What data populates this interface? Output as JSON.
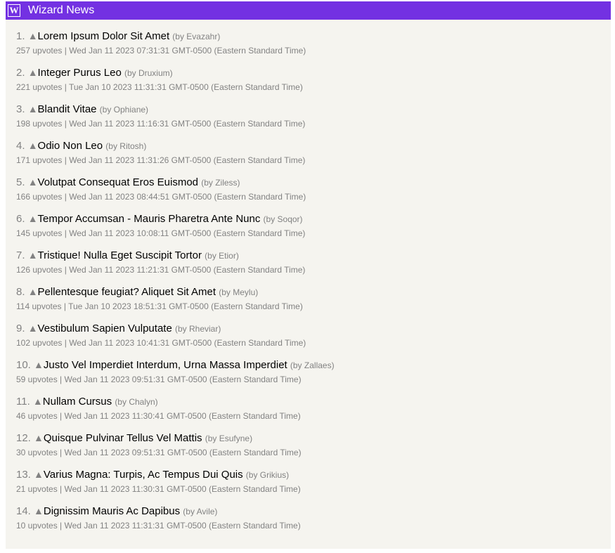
{
  "header": {
    "logo_letter": "W",
    "title": "Wizard News"
  },
  "upvote_icon": "triangle-up",
  "posts": [
    {
      "rank": "1.",
      "title": "Lorem Ipsum Dolor Sit Amet",
      "author": "(by Evazahr)",
      "upvotes": "257 upvotes",
      "date": "Wed Jan 11 2023 07:31:31 GMT-0500 (Eastern Standard Time)"
    },
    {
      "rank": "2.",
      "title": "Integer Purus Leo",
      "author": "(by Druxium)",
      "upvotes": "221 upvotes",
      "date": "Tue Jan 10 2023 11:31:31 GMT-0500 (Eastern Standard Time)"
    },
    {
      "rank": "3.",
      "title": "Blandit Vitae",
      "author": "(by Ophiane)",
      "upvotes": "198 upvotes",
      "date": "Wed Jan 11 2023 11:16:31 GMT-0500 (Eastern Standard Time)"
    },
    {
      "rank": "4.",
      "title": "Odio Non Leo",
      "author": "(by Ritosh)",
      "upvotes": "171 upvotes",
      "date": "Wed Jan 11 2023 11:31:26 GMT-0500 (Eastern Standard Time)"
    },
    {
      "rank": "5.",
      "title": "Volutpat Consequat Eros Euismod",
      "author": "(by Ziless)",
      "upvotes": "166 upvotes",
      "date": "Wed Jan 11 2023 08:44:51 GMT-0500 (Eastern Standard Time)"
    },
    {
      "rank": "6.",
      "title": "Tempor Accumsan - Mauris Pharetra Ante Nunc",
      "author": "(by Soqor)",
      "upvotes": "145 upvotes",
      "date": "Wed Jan 11 2023 10:08:11 GMT-0500 (Eastern Standard Time)"
    },
    {
      "rank": "7.",
      "title": "Tristique! Nulla Eget Suscipit Tortor",
      "author": "(by Etior)",
      "upvotes": "126 upvotes",
      "date": "Wed Jan 11 2023 11:21:31 GMT-0500 (Eastern Standard Time)"
    },
    {
      "rank": "8.",
      "title": "Pellentesque feugiat? Aliquet Sit Amet",
      "author": "(by Meylu)",
      "upvotes": "114 upvotes",
      "date": "Tue Jan 10 2023 18:51:31 GMT-0500 (Eastern Standard Time)"
    },
    {
      "rank": "9.",
      "title": "Vestibulum Sapien Vulputate",
      "author": "(by Rheviar)",
      "upvotes": "102 upvotes",
      "date": "Wed Jan 11 2023 10:41:31 GMT-0500 (Eastern Standard Time)"
    },
    {
      "rank": "10.",
      "title": "Justo Vel Imperdiet Interdum, Urna Massa Imperdiet",
      "author": "(by Zallaes)",
      "upvotes": "59 upvotes",
      "date": "Wed Jan 11 2023 09:51:31 GMT-0500 (Eastern Standard Time)"
    },
    {
      "rank": "11.",
      "title": "Nullam Cursus",
      "author": "(by Chalyn)",
      "upvotes": "46 upvotes",
      "date": "Wed Jan 11 2023 11:30:41 GMT-0500 (Eastern Standard Time)"
    },
    {
      "rank": "12.",
      "title": "Quisque Pulvinar Tellus Vel Mattis",
      "author": "(by Esufyne)",
      "upvotes": "30 upvotes",
      "date": "Wed Jan 11 2023 09:51:31 GMT-0500 (Eastern Standard Time)"
    },
    {
      "rank": "13.",
      "title": "Varius Magna: Turpis, Ac Tempus Dui Quis",
      "author": "(by Grikius)",
      "upvotes": "21 upvotes",
      "date": "Wed Jan 11 2023 11:30:31 GMT-0500 (Eastern Standard Time)"
    },
    {
      "rank": "14.",
      "title": "Dignissim Mauris Ac Dapibus",
      "author": "(by Avile)",
      "upvotes": "10 upvotes",
      "date": "Wed Jan 11 2023 11:31:31 GMT-0500 (Eastern Standard Time)"
    }
  ]
}
